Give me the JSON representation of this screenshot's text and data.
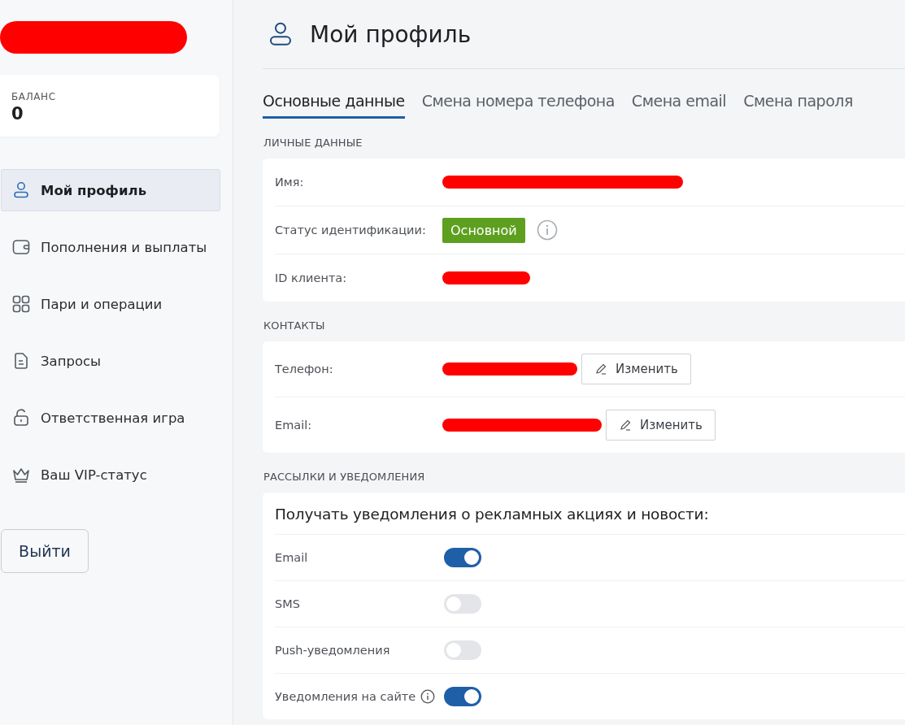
{
  "sidebar": {
    "balance": {
      "label": "БАЛАНС",
      "value": "0"
    },
    "items": [
      {
        "label": "Мой профиль",
        "selected": true
      },
      {
        "label": "Пополнения и выплаты",
        "selected": false
      },
      {
        "label": "Пари и операции",
        "selected": false
      },
      {
        "label": "Запросы",
        "selected": false
      },
      {
        "label": "Ответственная игра",
        "selected": false
      },
      {
        "label": "Ваш VIP-статус",
        "selected": false
      }
    ],
    "logout": "Выйти"
  },
  "page": {
    "title": "Мой профиль"
  },
  "tabs": [
    {
      "label": "Основные данные",
      "selected": true
    },
    {
      "label": "Смена номера телефона",
      "selected": false
    },
    {
      "label": "Смена email",
      "selected": false
    },
    {
      "label": "Смена пароля",
      "selected": false
    }
  ],
  "personal": {
    "heading": "ЛИЧНЫЕ ДАННЫЕ",
    "fields": [
      {
        "label": "Имя:",
        "kind": "redacted"
      },
      {
        "label": "Статус идентификации:",
        "kind": "badge",
        "value": "Основной"
      },
      {
        "label": "ID клиента:",
        "kind": "redacted"
      }
    ]
  },
  "contacts": {
    "heading": "КОНТАКТЫ",
    "fields": [
      {
        "label": "Телефон:",
        "kind": "redacted",
        "button": "Изменить"
      },
      {
        "label": "Email:",
        "kind": "redacted",
        "button": "Изменить"
      }
    ]
  },
  "notifications": {
    "heading": "РАССЫЛКИ И УВЕДОМЛЕНИЯ",
    "title": "Получать уведомления о рекламных акциях и новости:",
    "items": [
      {
        "label": "Email",
        "on": true,
        "info": false
      },
      {
        "label": "SMS",
        "on": false,
        "info": false
      },
      {
        "label": "Push-уведомления",
        "on": false,
        "info": false
      },
      {
        "label": "Уведомления на сайте",
        "on": true,
        "info": true
      }
    ]
  }
}
